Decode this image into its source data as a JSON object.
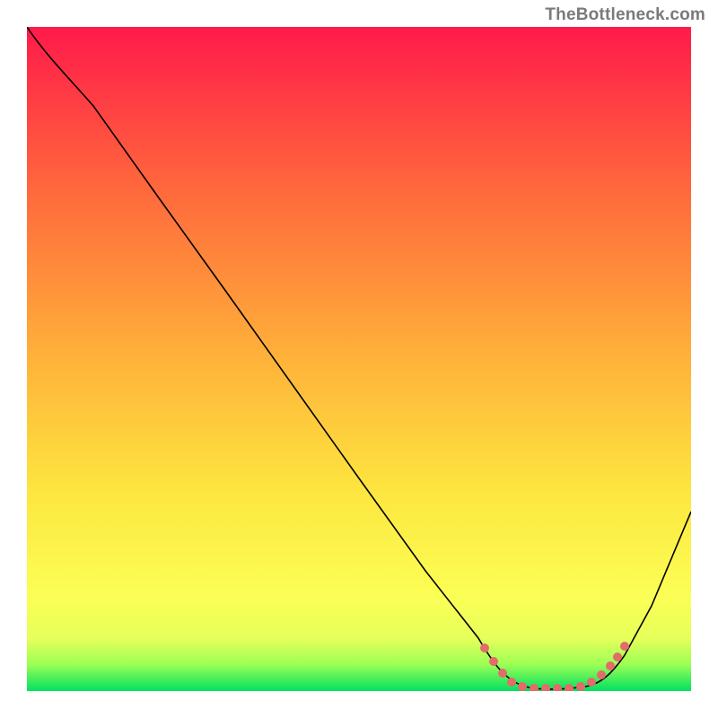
{
  "watermark": "TheBottleneck.com",
  "chart_data": {
    "type": "line",
    "title": "",
    "xlabel": "",
    "ylabel": "",
    "xlim": [
      0,
      100
    ],
    "ylim": [
      0,
      100
    ],
    "background": {
      "type": "vertical-gradient",
      "stops": [
        {
          "pos": 0,
          "color": "#ff1a4a"
        },
        {
          "pos": 25,
          "color": "#ff6a3c"
        },
        {
          "pos": 50,
          "color": "#ffb23a"
        },
        {
          "pos": 70,
          "color": "#fde63f"
        },
        {
          "pos": 86,
          "color": "#fbff55"
        },
        {
          "pos": 92,
          "color": "#e7ff5a"
        },
        {
          "pos": 96,
          "color": "#9cff55"
        },
        {
          "pos": 100,
          "color": "#00e060"
        }
      ]
    },
    "series": [
      {
        "name": "curve",
        "color": "#000000",
        "width": 1.5,
        "points": [
          {
            "x": 0,
            "y": 100
          },
          {
            "x": 4,
            "y": 97
          },
          {
            "x": 10,
            "y": 91
          },
          {
            "x": 20,
            "y": 77
          },
          {
            "x": 30,
            "y": 63
          },
          {
            "x": 40,
            "y": 49
          },
          {
            "x": 50,
            "y": 35
          },
          {
            "x": 60,
            "y": 21
          },
          {
            "x": 68,
            "y": 8
          },
          {
            "x": 72,
            "y": 2
          },
          {
            "x": 75,
            "y": 0.5
          },
          {
            "x": 80,
            "y": 0.5
          },
          {
            "x": 84,
            "y": 0.5
          },
          {
            "x": 88,
            "y": 3
          },
          {
            "x": 92,
            "y": 10
          },
          {
            "x": 96,
            "y": 18
          },
          {
            "x": 100,
            "y": 27
          }
        ]
      },
      {
        "name": "highlight-band",
        "color": "#e46b6b",
        "style": "dotted-thick",
        "points": [
          {
            "x": 69,
            "y": 6
          },
          {
            "x": 73,
            "y": 1
          },
          {
            "x": 78,
            "y": 0.5
          },
          {
            "x": 83,
            "y": 0.5
          },
          {
            "x": 87,
            "y": 2
          },
          {
            "x": 90,
            "y": 7
          }
        ]
      }
    ]
  }
}
